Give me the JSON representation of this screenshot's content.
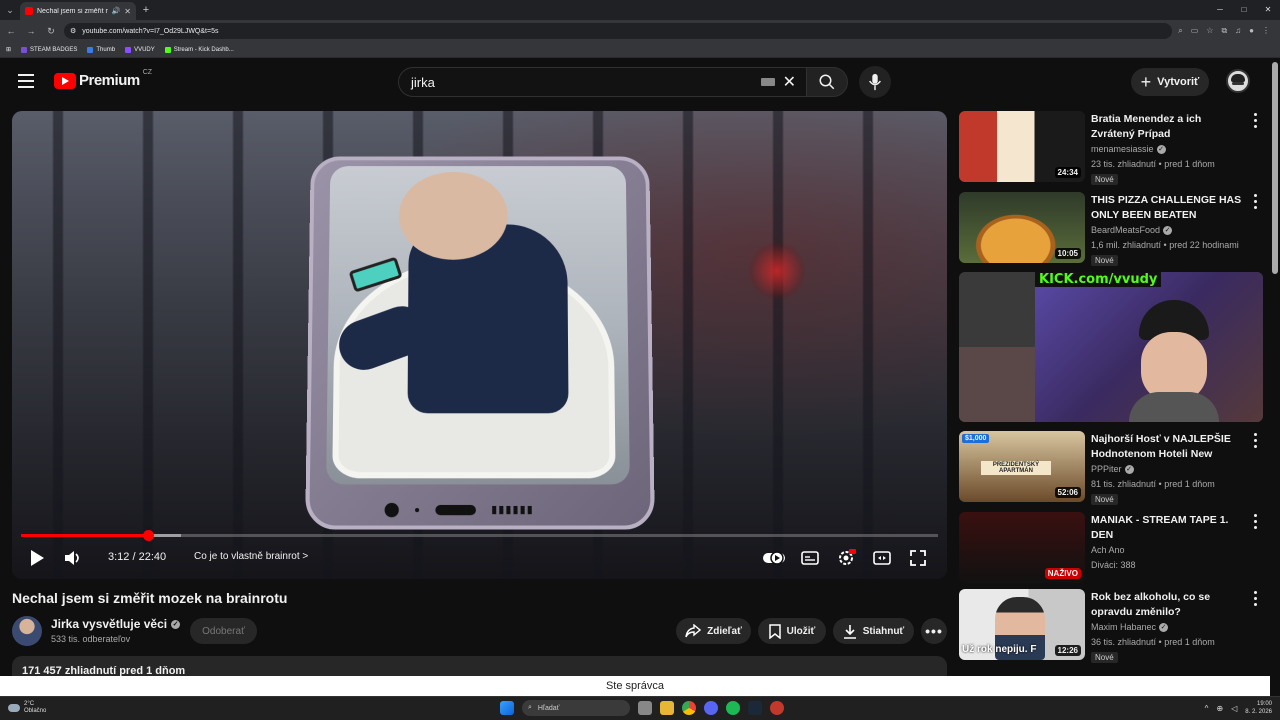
{
  "browser": {
    "tab_title": "Nechal jsem si změřit mozek na brainrot",
    "url": "youtube.com/watch?v=I7_Od29LJWQ&t=5s",
    "bookmarks": [
      {
        "label": "STEAM BADGES",
        "color": "#7a4fd6"
      },
      {
        "label": "Thumb",
        "color": "#3b7be3"
      },
      {
        "label": "VVUDY",
        "color": "#8a4fff"
      },
      {
        "label": "Stream - Kick Dashb...",
        "color": "#53fc18"
      }
    ]
  },
  "header": {
    "logo_text": "Premium",
    "country": "CZ",
    "search_value": "jirka",
    "create_label": "Vytvoriť"
  },
  "player": {
    "progress_fraction": 0.139,
    "buffered_fraction": 0.175,
    "time": "3:12 / 22:40",
    "chapter": "Co je to vlastně brainrot",
    "chapter_arrow": ">"
  },
  "video": {
    "title": "Nechal jsem si změřit mozek na brainrotu",
    "channel": "Jirka vysvětluje věci",
    "subscribers": "533 tis. odberateľov",
    "unsubscribe_label": "Odoberať",
    "share_label": "Zdieľať",
    "save_label": "Uložiť",
    "download_label": "Stiahnuť",
    "description_preview": "171 457 zhliadnutí  pred 1 dňom"
  },
  "recommendations": [
    {
      "title": "Bratia Menendez a ich Zvrátený Prípad",
      "channel": "menamesiassie",
      "verified": true,
      "meta": "23 tis. zhliadnutí • pred 1 dňom",
      "duration": "24:34",
      "badge": "Nové",
      "thumb_colors": [
        "#c0392b",
        "#f5e6d0"
      ]
    },
    {
      "title": "THIS PIZZA CHALLENGE HAS ONLY BEEN BEATEN ONCE...B...",
      "channel": "BeardMeatsFood",
      "verified": true,
      "meta": "1,6 mil. zhliadnutí • pred 22 hodinami",
      "duration": "10:05",
      "badge": "Nové",
      "thumb_colors": [
        "#d88a2e",
        "#5a6d3a"
      ]
    },
    {
      "title": "Najhorší Hosť v NAJLEPŠIE Hodnotenom Hoteli New York...",
      "channel": "PPPiter",
      "verified": true,
      "meta": "81 tis. zhliadnutí • pred 1 dňom",
      "duration": "52:06",
      "badge": "Nové",
      "price": "$1,000",
      "sign": "PREZIDENTSKÝ APARTMÁN",
      "thumb_colors": [
        "#d8b27a",
        "#6b4a2a"
      ]
    },
    {
      "title": "MANIAK - STREAM TAPE 1. DEN",
      "channel": "Ach Ano",
      "verified": false,
      "meta": "Diváci: 388",
      "live_label": "NAŽIVO",
      "badge": "",
      "thumb_colors": [
        "#3a1010",
        "#222"
      ]
    },
    {
      "title": "Rok bez alkoholu, co se opravdu změnilo?",
      "channel": "Maxim Habanec",
      "verified": true,
      "meta": "36 tis. zhliadnutí • pred 1 dňom",
      "duration": "12:26",
      "badge": "Nové",
      "overlay": "Už rok nepiju. F",
      "thumb_colors": [
        "#e9e9e9",
        "#2a3a55"
      ]
    }
  ],
  "featured_stream": {
    "banner": "KICK.com/vvudy"
  },
  "admin_notice": "Ste správca",
  "taskbar": {
    "weather_temp": "2°C",
    "weather_desc": "Oblačno",
    "search_placeholder": "Hľadať",
    "time": "19:00",
    "date": "8. 2. 2026"
  }
}
